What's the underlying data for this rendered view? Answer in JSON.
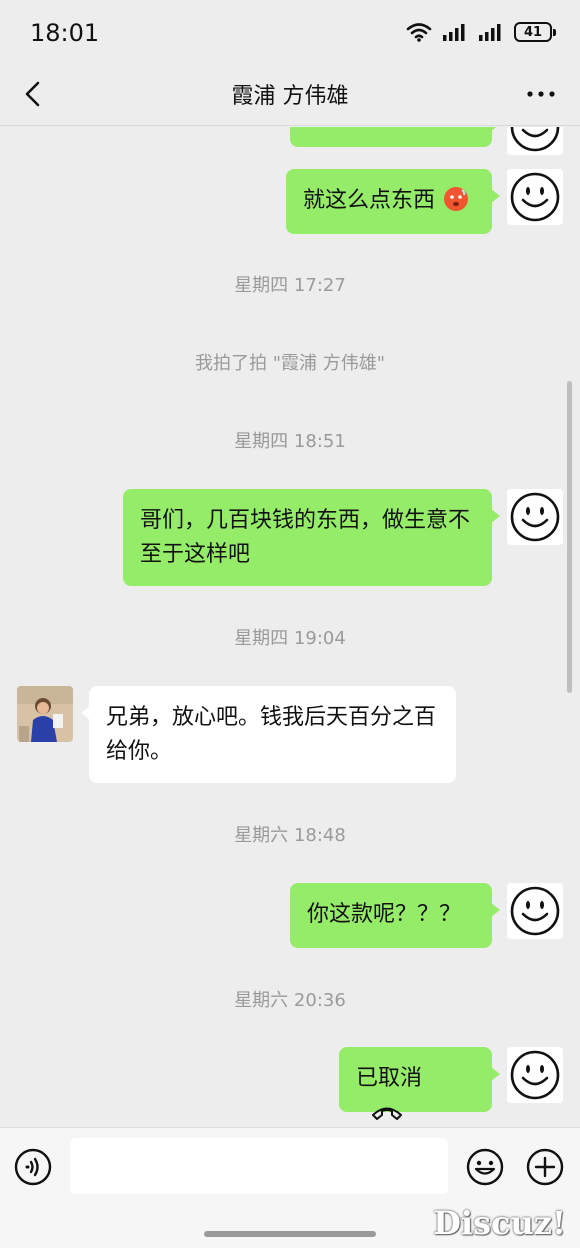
{
  "status_bar": {
    "time": "18:01",
    "battery": "41"
  },
  "nav": {
    "title": "霞浦 方伟雄"
  },
  "messages": {
    "m1": "就这么点东西",
    "t1": "星期四 17:27",
    "sys1": "我拍了拍 \"霞浦 方伟雄\"",
    "t2": "星期四 18:51",
    "m2": "哥们，几百块钱的东西，做生意不至于这样吧",
    "t3": "星期四 19:04",
    "m3": "兄弟，放心吧。钱我后天百分之百给你。",
    "t4": "星期六 18:48",
    "m4": "你这款呢？？？",
    "t5": "星期六 20:36",
    "m5": "已取消"
  },
  "watermark": "Discuz!",
  "colors": {
    "me_bubble": "#95ec69",
    "other_bubble": "#ffffff",
    "background": "#ededed"
  }
}
